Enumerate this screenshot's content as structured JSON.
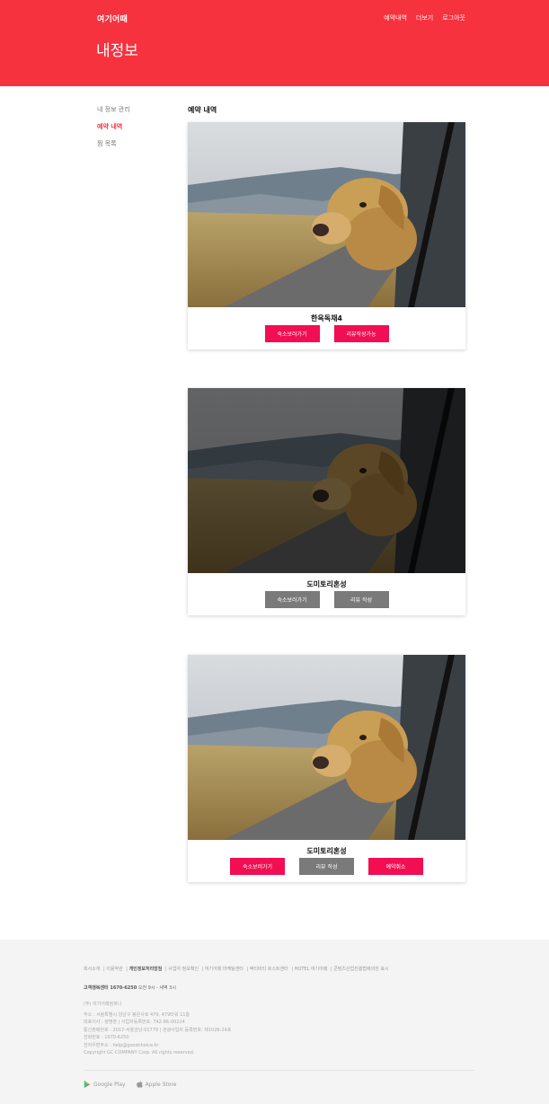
{
  "header": {
    "logo": "여기어때",
    "nav": [
      "예약내역",
      "더보기",
      "로그아웃"
    ],
    "page_title": "내정보"
  },
  "sidebar": {
    "items": [
      {
        "label": "내 정보 관리",
        "active": false
      },
      {
        "label": "예약 내역",
        "active": true
      },
      {
        "label": "찜 목록",
        "active": false
      }
    ]
  },
  "main": {
    "section_title": "예약 내역",
    "reservations": [
      {
        "name": "한옥독채4",
        "dimmed": false,
        "buttons": [
          {
            "label": "숙소보러가기",
            "style": "pink"
          },
          {
            "label": "리뷰작성가능",
            "style": "pink"
          }
        ]
      },
      {
        "name": "도미토리혼성",
        "dimmed": true,
        "buttons": [
          {
            "label": "숙소보러가기",
            "style": "gray"
          },
          {
            "label": "리뷰 작성",
            "style": "gray"
          }
        ]
      },
      {
        "name": "도미토리혼성",
        "dimmed": false,
        "buttons": [
          {
            "label": "숙소보러가기",
            "style": "pink"
          },
          {
            "label": "리뷰 작성",
            "style": "gray"
          },
          {
            "label": "예약취소",
            "style": "pink"
          }
        ]
      }
    ]
  },
  "footer": {
    "links": [
      "회사소개",
      "이용약관",
      "개인정보처리방침",
      "사업자 정보확인",
      "여기어때 마케팅센터",
      "액티비티 호스트센터",
      "HOTEL 여기어때",
      "콘텐츠산업진흥법에의한 표시"
    ],
    "cs": {
      "label": "고객행복센터 1670-6250",
      "hours": "오전 9시 - 새벽 3시"
    },
    "company_lines": [
      "(주) 여기어때컴퍼니",
      "주소 : 서울특별시 강남구 봉은사로 479, 479타워 11층",
      "대표이사 : 정명훈 | 사업자등록번호: 742-86-00224",
      "통신판매번호 : 2017-서울강남-01779 | 관광사업자 등록번호: 제1026-24호",
      "전화번호 : 1670-6250",
      "전자우편주소 : help@goodchoice.kr",
      "Copyright GC COMPANY Corp. All rights reserved."
    ],
    "apps": [
      "Google Play",
      "Apple Store"
    ]
  },
  "colors": {
    "brand": "#f7323f",
    "button_pink": "#f20e52",
    "button_gray": "#7a7a7a"
  }
}
